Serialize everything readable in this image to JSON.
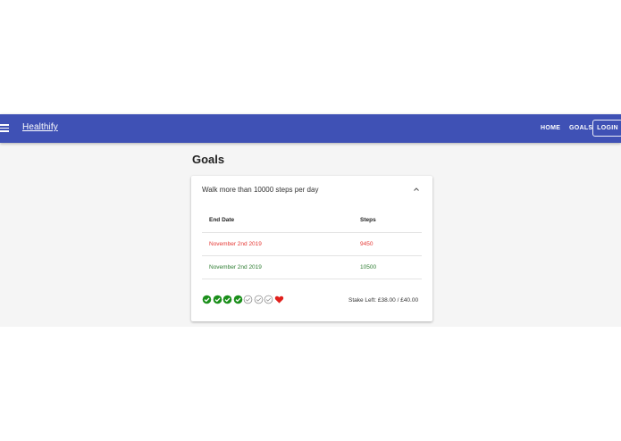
{
  "appbar": {
    "brand": "Healthify",
    "nav": {
      "home": "HOME",
      "goals": "GOALS",
      "login": "LOGIN"
    },
    "color": "#3f51b5"
  },
  "page": {
    "title": "Goals"
  },
  "goal": {
    "title": "Walk more than 10000 steps per day",
    "expanded": true,
    "table": {
      "headers": {
        "end_date": "End Date",
        "steps": "Steps"
      },
      "rows": [
        {
          "end_date": "November 2nd 2019",
          "steps": "9450",
          "status": "failed"
        },
        {
          "end_date": "November 2nd 2019",
          "steps": "10500",
          "status": "achieved"
        }
      ]
    },
    "progress": {
      "days": [
        "done",
        "done",
        "done",
        "done",
        "pending",
        "pending",
        "pending",
        "heart"
      ],
      "icons": {
        "done": "check-circle-filled-icon",
        "pending": "check-circle-outline-icon",
        "heart": "heart-icon"
      },
      "colors": {
        "done": "#1b8f1b",
        "pending": "#9e9e9e",
        "heart": "#e0201c"
      }
    },
    "stake_text": "Stake Left: £38.00 / £40.00"
  },
  "colors": {
    "fail": "#e53935",
    "success": "#2e7d32"
  }
}
